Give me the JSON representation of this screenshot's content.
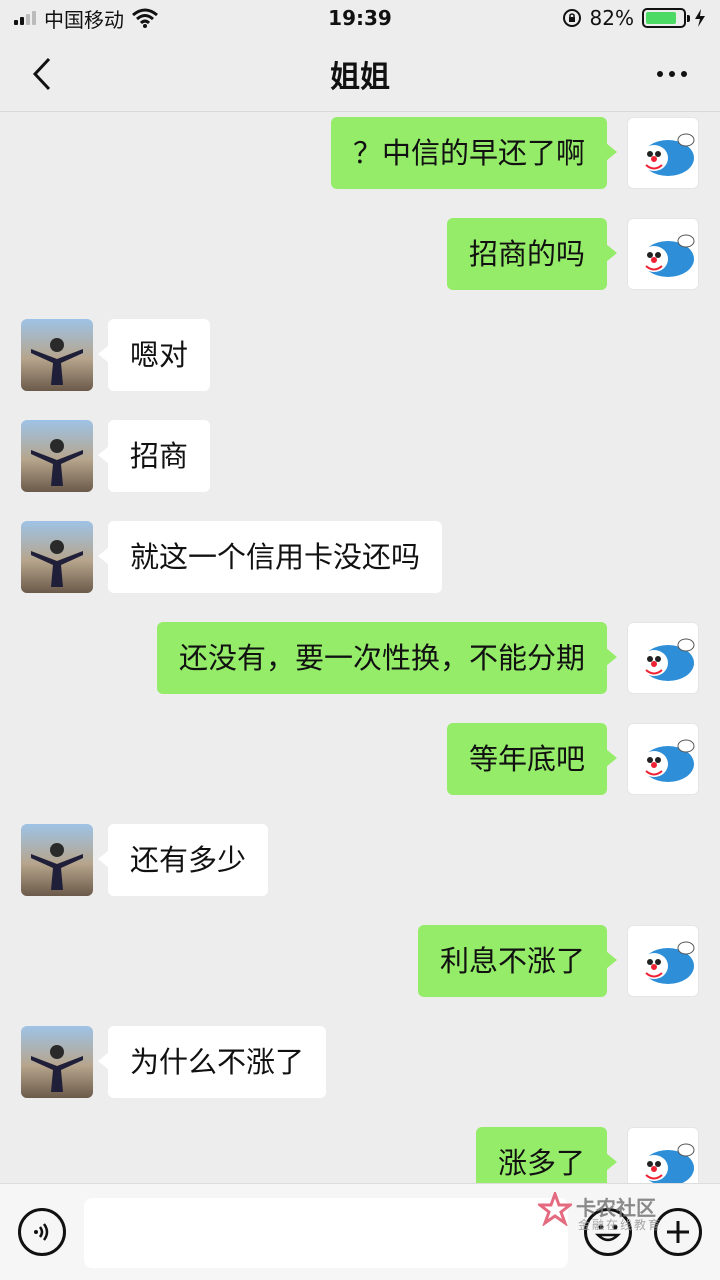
{
  "status_bar": {
    "carrier": "中国移动",
    "time": "19:39",
    "battery_percent": "82%",
    "battery_level": 0.82
  },
  "nav": {
    "title": "姐姐",
    "back_icon": "chevron-left-icon",
    "more_icon": "more-dots-icon"
  },
  "messages": [
    {
      "direction": "out",
      "text": "？中信的早还了啊"
    },
    {
      "direction": "out",
      "text": "招商的吗"
    },
    {
      "direction": "in",
      "text": "嗯对"
    },
    {
      "direction": "in",
      "text": "招商"
    },
    {
      "direction": "in",
      "text": "就这一个信用卡没还吗"
    },
    {
      "direction": "out",
      "text": "还没有，要一次性换，不能分期"
    },
    {
      "direction": "out",
      "text": "等年底吧"
    },
    {
      "direction": "in",
      "text": "还有多少"
    },
    {
      "direction": "out",
      "text": "利息不涨了"
    },
    {
      "direction": "in",
      "text": "为什么不涨了"
    },
    {
      "direction": "out",
      "text": "涨多了"
    }
  ],
  "input_bar": {
    "placeholder": "",
    "voice_icon": "voice-icon",
    "emoji_icon": "emoji-icon",
    "plus_icon": "plus-icon"
  },
  "watermark": {
    "title": "卡农社区",
    "subtitle": "金融在线教育"
  },
  "colors": {
    "outgoing_bubble": "#95ec69",
    "incoming_bubble": "#ffffff",
    "background": "#ededed"
  }
}
